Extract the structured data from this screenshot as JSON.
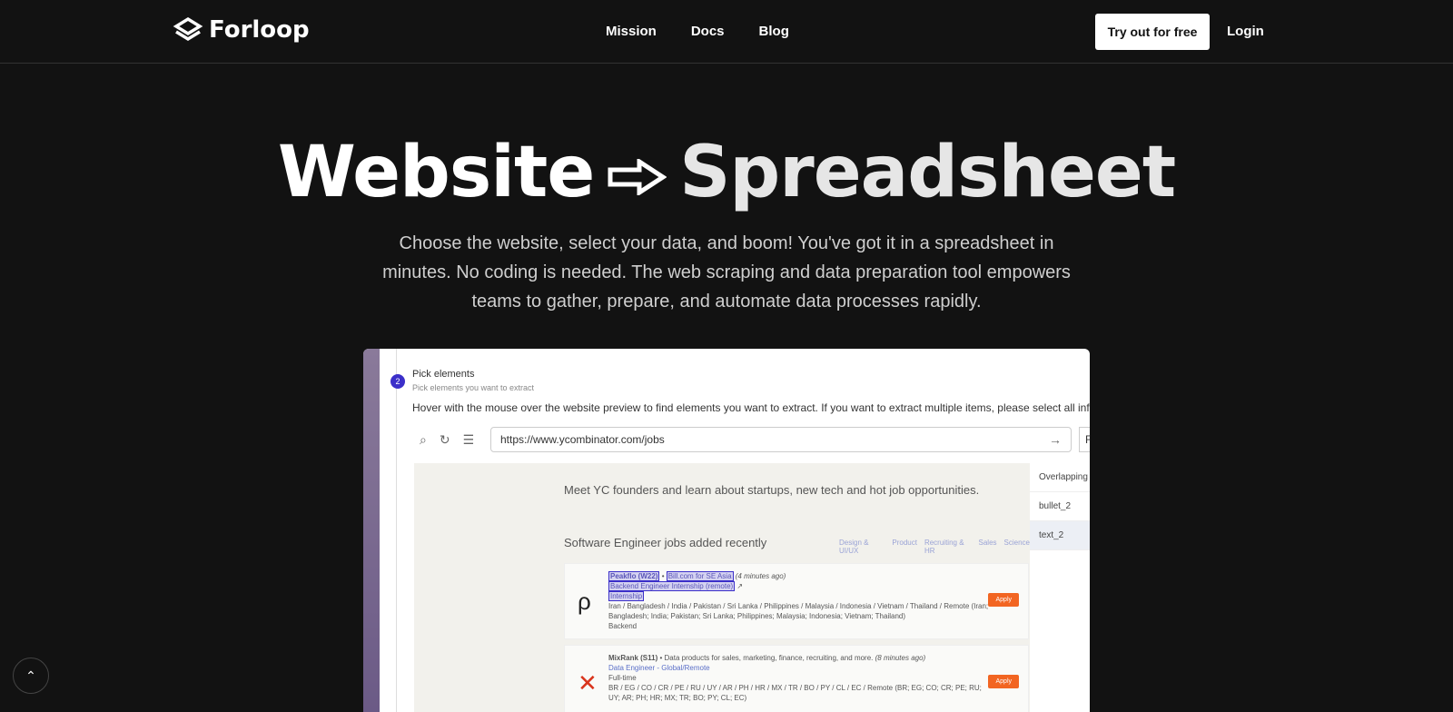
{
  "nav": {
    "brand": "Forloop",
    "links": [
      "Mission",
      "Docs",
      "Blog"
    ],
    "cta": "Try out for free",
    "login": "Login"
  },
  "hero": {
    "title_left": "Website",
    "title_right": "Spreadsheet",
    "subtitle": "Choose the website, select your data, and boom! You've got it in a spreadsheet in minutes. No coding is needed. The web scraping and data preparation tool empowers teams to gather, prepare, and automate data processes rapidly."
  },
  "app": {
    "step_number": "2",
    "step_title": "Pick elements",
    "step_subtitle": "Pick elements you want to extract",
    "instructions": "Hover with the mouse over the website preview to find elements you want to extract. If you want to extract multiple items, please select all inform",
    "url": "https://www.ycombinator.com/jobs",
    "filter_label": "Filt",
    "overlapping": {
      "title": "Overlapping",
      "items": [
        "bullet_2",
        "text_2"
      ]
    },
    "preview": {
      "intro": "Meet YC founders and learn about startups, new tech and hot job opportunities.",
      "section": "Software Engineer jobs added recently",
      "categories": [
        "Design & UI/UX",
        "Product",
        "Recruiting & HR",
        "Sales",
        "Science"
      ],
      "jobs": [
        {
          "company": "Peakflo (W22)",
          "desc": "Bill.com for SE Asia",
          "age": "(4 minutes ago)",
          "title": "Backend Engineer Internship (remote)",
          "type": "Internship",
          "location": "Iran / Bangladesh / India / Pakistan / Sri Lanka / Philippines / Malaysia / Indonesia / Vietnam / Thailand / Remote (Iran; Bangladesh; India; Pakistan; Sri Lanka; Philippines; Malaysia; Indonesia; Vietnam; Thailand)",
          "dept": "Backend",
          "apply": "Apply"
        },
        {
          "company": "MixRank (S11)",
          "desc": "Data products for sales, marketing, finance, recruiting, and more.",
          "age": "(8 minutes ago)",
          "title": "Data Engineer - Global/Remote",
          "type": "Full-time",
          "location": "BR / EG / CO / CR / PE / RU / UY / AR / PH / HR / MX / TR / BO / PY / CL / EC / Remote (BR; EG; CO; CR; PE; RU; UY; AR; PH; HR; MX; TR; BO; PY; CL; EC)",
          "apply": "Apply"
        }
      ]
    }
  },
  "colors": {
    "background": "#121212",
    "accent": "#3b2fc9",
    "apply": "#f26522"
  }
}
